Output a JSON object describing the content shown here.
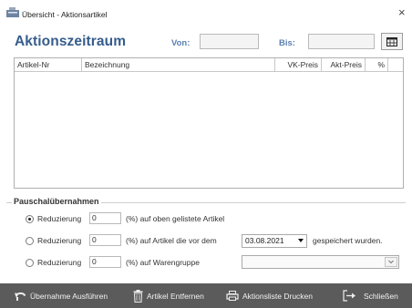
{
  "window": {
    "title": "Übersicht - Aktionsartikel",
    "close_glyph": "×"
  },
  "header": {
    "heading": "Aktionszeitraum",
    "von_label": "Von:",
    "von_value": "",
    "bis_label": "Bis:",
    "bis_value": "",
    "calendar_icon": "calendar-icon"
  },
  "table": {
    "columns": [
      "Artikel-Nr",
      "Bezeichnung",
      "VK-Preis",
      "Akt-Preis",
      "%"
    ],
    "rows": []
  },
  "group": {
    "title": "Pauschalübernahmen",
    "options": [
      {
        "radio_label": "Reduzierung",
        "value": "0",
        "suffix": "(%) auf oben gelistete Artikel",
        "checked": true
      },
      {
        "radio_label": "Reduzierung",
        "value": "0",
        "suffix": "(%) auf Artikel die vor dem",
        "date": "03.08.2021",
        "after": "gespeichert wurden.",
        "checked": false
      },
      {
        "radio_label": "Reduzierung",
        "value": "0",
        "suffix": "(%) auf Warengruppe",
        "warengruppe": "",
        "checked": false
      }
    ]
  },
  "toolbar": {
    "buttons": [
      {
        "label": "Übernahme Ausführen",
        "icon": "undo-arrow-icon"
      },
      {
        "label": "Artikel Entfernen",
        "icon": "trash-icon"
      },
      {
        "label": "Aktionsliste Drucken",
        "icon": "printer-icon"
      },
      {
        "label": "Schließen",
        "icon": "exit-icon"
      }
    ]
  },
  "colors": {
    "heading": "#355c8c",
    "field_label": "#5b7fb2",
    "toolbar_bg": "#5b5b5b",
    "toolbar_text": "#f2f2f2"
  }
}
